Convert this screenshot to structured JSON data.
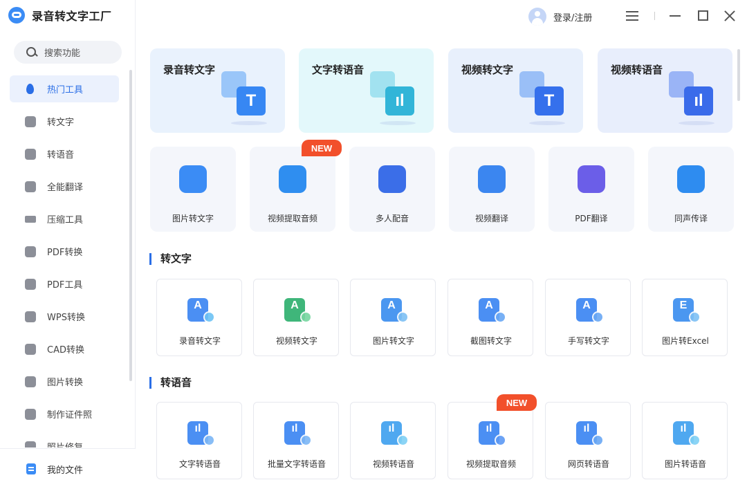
{
  "app": {
    "title": "录音转文字工厂"
  },
  "search": {
    "placeholder": "搜索功能"
  },
  "sidebar": {
    "items": [
      {
        "label": "热门工具",
        "icon": "fire-icon",
        "active": true
      },
      {
        "label": "转文字",
        "icon": "text-icon"
      },
      {
        "label": "转语音",
        "icon": "voice-icon"
      },
      {
        "label": "全能翻译",
        "icon": "translate-icon"
      },
      {
        "label": "压缩工具",
        "icon": "compress-icon"
      },
      {
        "label": "PDF转换",
        "icon": "pdf-convert-icon"
      },
      {
        "label": "PDF工具",
        "icon": "toolbox-icon"
      },
      {
        "label": "WPS转换",
        "icon": "wps-icon"
      },
      {
        "label": "CAD转换",
        "icon": "cad-icon"
      },
      {
        "label": "图片转换",
        "icon": "image-icon"
      },
      {
        "label": "制作证件照",
        "icon": "id-photo-icon"
      },
      {
        "label": "照片修复",
        "icon": "photo-repair-icon"
      }
    ],
    "bottom_label": "我的文件"
  },
  "header": {
    "login_label": "登录/注册"
  },
  "hero_cards": [
    {
      "title": "录音转文字",
      "front_glyph": "T",
      "bg": "#e9f2fd"
    },
    {
      "title": "文字转语音",
      "front_glyph": "ıl",
      "bg": "#e3f8fb"
    },
    {
      "title": "视频转文字",
      "front_glyph": "T",
      "bg": "#e8f0fc"
    },
    {
      "title": "视频转语音",
      "front_glyph": "ıl",
      "bg": "#e8eefc"
    }
  ],
  "tools": [
    {
      "label": "图片转文字",
      "icon": "image-to-text-icon",
      "color": "#3b8cf5"
    },
    {
      "label": "视频提取音频",
      "icon": "extract-audio-icon",
      "color": "#2f8ef0",
      "badge": "NEW"
    },
    {
      "label": "多人配音",
      "icon": "multi-voice-icon",
      "color": "#3b6ee8"
    },
    {
      "label": "视频翻译",
      "icon": "video-translate-icon",
      "color": "#3b86f0"
    },
    {
      "label": "PDF翻译",
      "icon": "pdf-translate-icon",
      "color": "#6b5ee8"
    },
    {
      "label": "同声传译",
      "icon": "interpretation-icon",
      "color": "#2e8cf0"
    }
  ],
  "sections": [
    {
      "title": "转文字",
      "items": [
        {
          "label": "录音转文字",
          "glyph": "A",
          "color": "#4b8ff3",
          "badge_color": "#6dc3f5"
        },
        {
          "label": "视频转文字",
          "glyph": "A",
          "color": "#3fb67a",
          "badge_color": "#76d6a0"
        },
        {
          "label": "图片转文字",
          "glyph": "A",
          "color": "#4b97f0",
          "badge_color": "#7ec0f4"
        },
        {
          "label": "截图转文字",
          "glyph": "A",
          "color": "#4b8ff3",
          "badge_color": "#6aa8f5"
        },
        {
          "label": "手写转文字",
          "glyph": "A",
          "color": "#4b8ff3",
          "badge_color": "#6aa8f5"
        },
        {
          "label": "图片转Excel",
          "glyph": "E",
          "color": "#4b97f0",
          "badge_color": "#7ec0f4"
        }
      ]
    },
    {
      "title": "转语音",
      "items": [
        {
          "label": "文字转语音",
          "glyph": "ıl",
          "color": "#4b8ff3",
          "badge_color": "#7cb6f6"
        },
        {
          "label": "批量文字转语音",
          "glyph": "ıl",
          "color": "#4b8ff3",
          "badge_color": "#7cb6f6"
        },
        {
          "label": "视频转语音",
          "glyph": "ıl",
          "color": "#4fa8f0",
          "badge_color": "#7fd0f5"
        },
        {
          "label": "视频提取音频",
          "glyph": "ıl",
          "color": "#4b8ff3",
          "badge_color": "#5d9af5",
          "badge": "NEW"
        },
        {
          "label": "网页转语音",
          "glyph": "ıl",
          "color": "#4b8ff3",
          "badge_color": "#6aa8f5"
        },
        {
          "label": "图片转语音",
          "glyph": "ıl",
          "color": "#4fa8f0",
          "badge_color": "#7fd0f5"
        }
      ]
    }
  ]
}
